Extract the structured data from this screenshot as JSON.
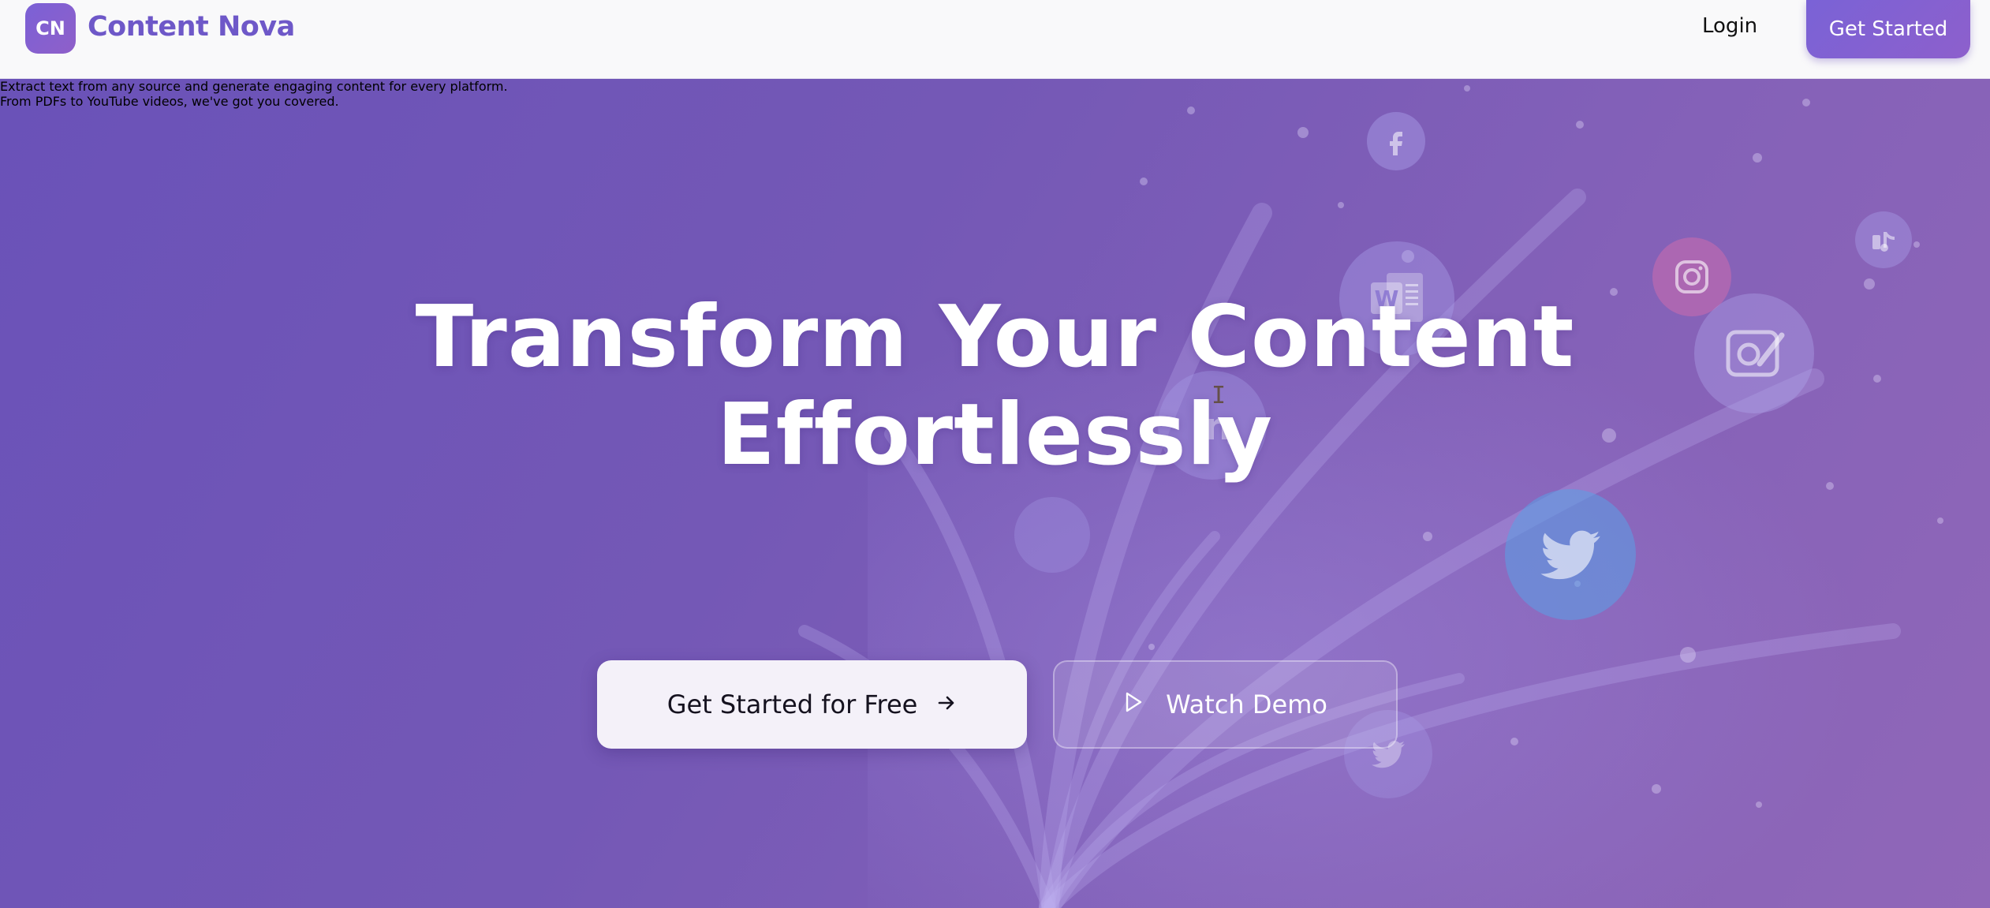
{
  "header": {
    "logo_badge": "CN",
    "brand_name": "Content Nova",
    "login_label": "Login",
    "cta_label": "Get Started"
  },
  "hero": {
    "title_line1": "Transform Your Content",
    "title_line2": "Effortlessly",
    "subtitle_line1": "Extract text from any source and generate engaging content for every platform.",
    "subtitle_line2": "From PDFs to YouTube videos, we've got you covered.",
    "primary_button_label": "Get Started for Free",
    "primary_button_icon": "arrow-right-icon",
    "secondary_button_label": "Watch Demo",
    "secondary_button_icon": "play-icon"
  },
  "background_icons": [
    "facebook-icon",
    "instagram-icon",
    "tiktok-icon",
    "word-document-icon",
    "image-edit-icon",
    "twitter-icon",
    "twitter-icon",
    "linkedin-icon"
  ],
  "colors": {
    "brand": "#6e58c8",
    "hero_start": "#6a52b8",
    "hero_end": "#9067b8",
    "primary_button_bg": "#f4f1f9"
  }
}
